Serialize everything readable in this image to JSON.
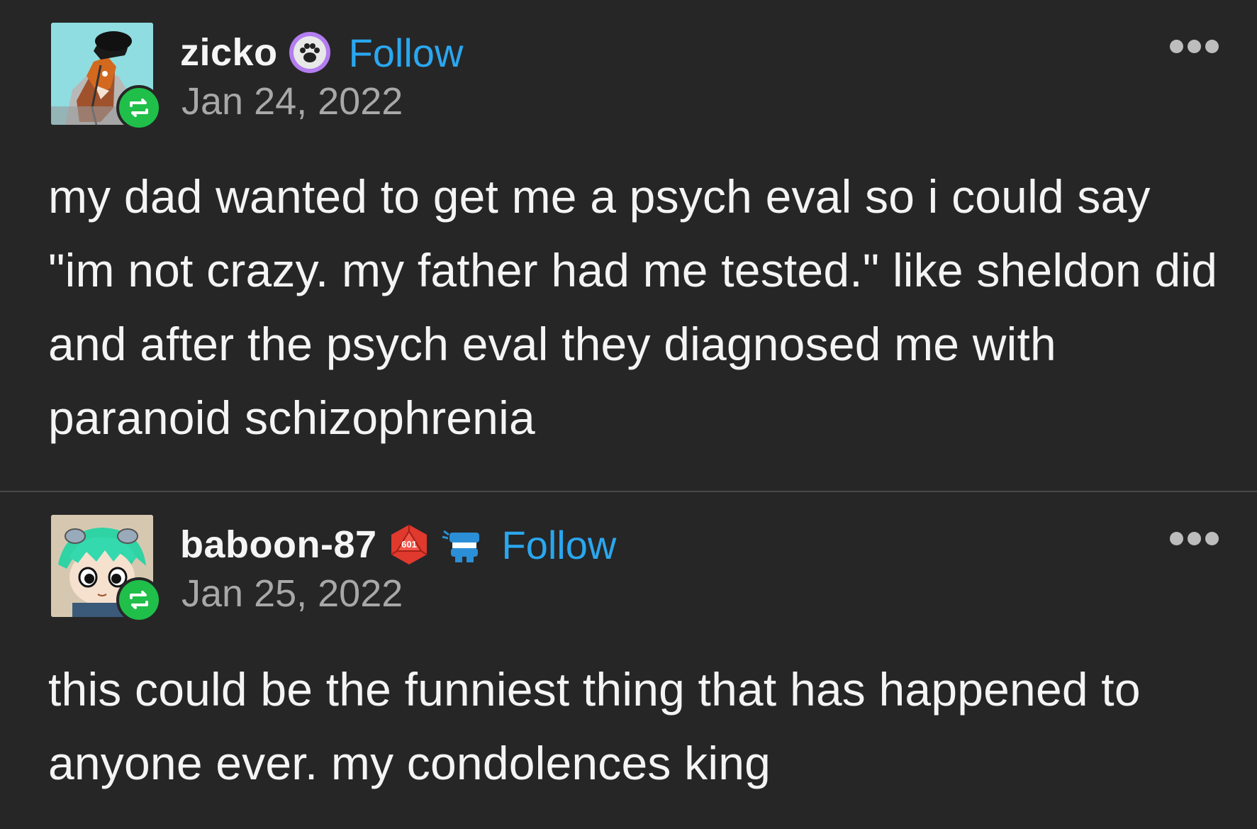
{
  "posts": [
    {
      "username": "zicko",
      "follow_label": "Follow",
      "date": "Jan 24, 2022",
      "body": "my dad wanted to get me a psych eval so i could say \"im not crazy. my father had me tested.\" like sheldon did and after the psych eval they diagnosed me with paranoid schizophrenia",
      "badges": [
        "paw-badge-icon"
      ]
    },
    {
      "username": "baboon-87",
      "follow_label": "Follow",
      "date": "Jan 25, 2022",
      "body": "this could be the funniest thing that has happened to anyone ever. my condolences king",
      "badges": [
        "d20-badge-icon",
        "chattering-teeth-badge-icon"
      ],
      "badge_text": "601"
    }
  ],
  "colors": {
    "background": "#262626",
    "follow": "#2aa7f0",
    "reblog_badge": "#1fbf49",
    "date": "#a8a8a8"
  }
}
